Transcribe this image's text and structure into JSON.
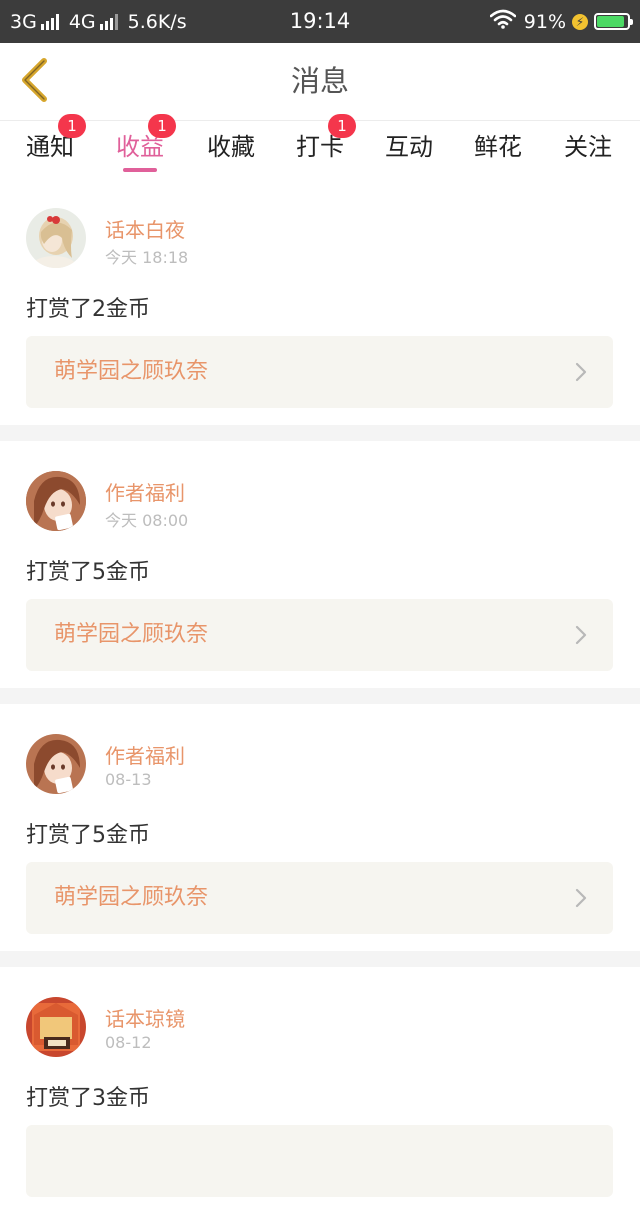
{
  "status_bar": {
    "net1": "3G",
    "net2": "4G",
    "speed": "5.6K/s",
    "time": "19:14",
    "battery_text": "91%",
    "battery_level": 0.91,
    "icons": [
      "signal-icon",
      "wifi-icon",
      "charging-icon",
      "battery-icon"
    ]
  },
  "header": {
    "title": "消息",
    "back_icon": "chevron-left-icon"
  },
  "tabs": [
    {
      "label": "通知",
      "badge": "1",
      "active": false
    },
    {
      "label": "收益",
      "badge": "1",
      "active": true
    },
    {
      "label": "收藏",
      "badge": "",
      "active": false
    },
    {
      "label": "打卡",
      "badge": "1",
      "active": false
    },
    {
      "label": "互动",
      "badge": "",
      "active": false
    },
    {
      "label": "鲜花",
      "badge": "",
      "active": false
    },
    {
      "label": "关注",
      "badge": "",
      "active": false
    }
  ],
  "messages": [
    {
      "sender": "话本白夜",
      "time": "今天 18:18",
      "text": "打赏了2金币",
      "book": "萌学园之顾玖奈"
    },
    {
      "sender": "作者福利",
      "time": "今天 08:00",
      "text": "打赏了5金币",
      "book": "萌学园之顾玖奈"
    },
    {
      "sender": "作者福利",
      "time": "08-13",
      "text": "打赏了5金币",
      "book": "萌学园之顾玖奈"
    },
    {
      "sender": "话本琼镜",
      "time": "08-12",
      "text": "打赏了3金币",
      "book": ""
    }
  ],
  "colors": {
    "accent": "#e0609a",
    "sender": "#e8956a",
    "badge": "#f4364c",
    "back_arrow": "#d6a62c"
  }
}
